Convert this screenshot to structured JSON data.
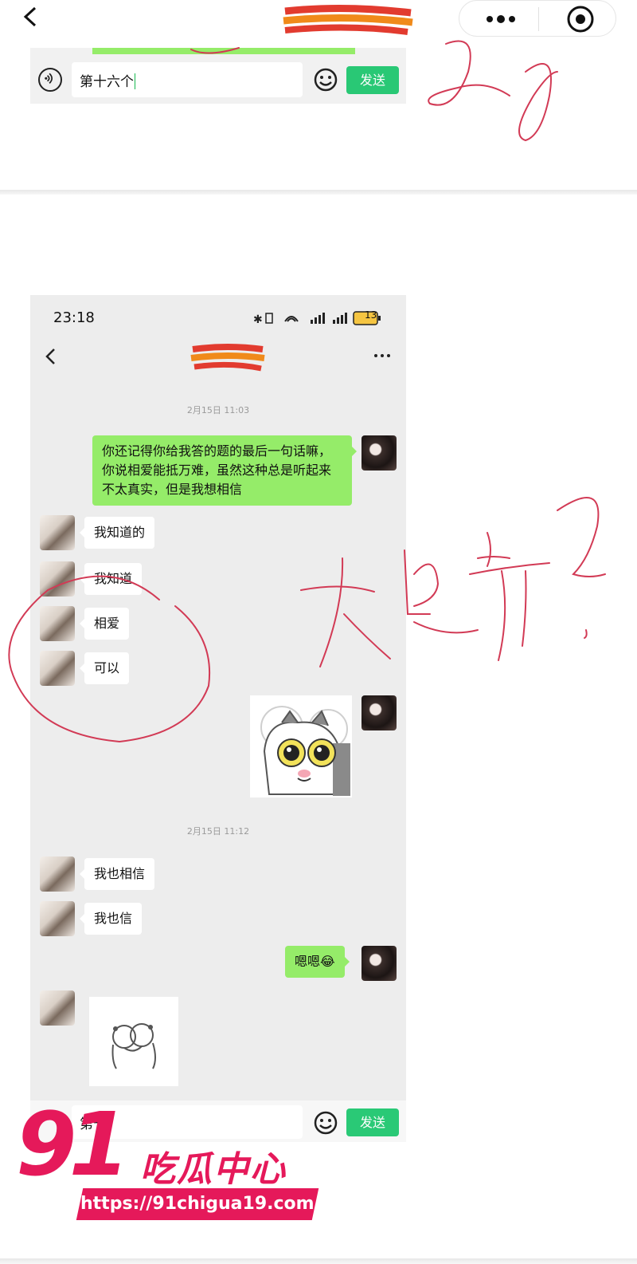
{
  "first_fragment": {
    "input_text": "第十六个",
    "send_label": "发送"
  },
  "phone": {
    "status_time": "23:18",
    "battery": "13",
    "timestamps": [
      "2月15日 11:03",
      "2月15日 11:12"
    ],
    "messages": [
      {
        "side": "right",
        "text": "你还记得你给我答的题的最后一句话嘛，你说相爱能抵万难，虽然这种总是听起来不太真实，但是我想相信"
      },
      {
        "side": "left",
        "text": "我知道的"
      },
      {
        "side": "left",
        "text": "我知道"
      },
      {
        "side": "left",
        "text": "相爱"
      },
      {
        "side": "left",
        "text": "可以"
      },
      {
        "side": "right",
        "type": "sticker",
        "text": ""
      },
      {
        "side": "left",
        "text": "我也相信"
      },
      {
        "side": "left",
        "text": "我也信"
      },
      {
        "side": "right",
        "text": "嗯嗯😂"
      },
      {
        "side": "left",
        "type": "sticker",
        "text": ""
      }
    ],
    "bottom_input_text": "第十",
    "send_label": "发送"
  },
  "watermark": {
    "logo_number": "91",
    "logo_text": "吃瓜中心",
    "url": "https://91chigua19.com"
  },
  "colors": {
    "green_bubble": "#95ec69",
    "send_button": "#07c160",
    "annotation_red": "#d23a55",
    "watermark_pink": "#e5195a"
  }
}
